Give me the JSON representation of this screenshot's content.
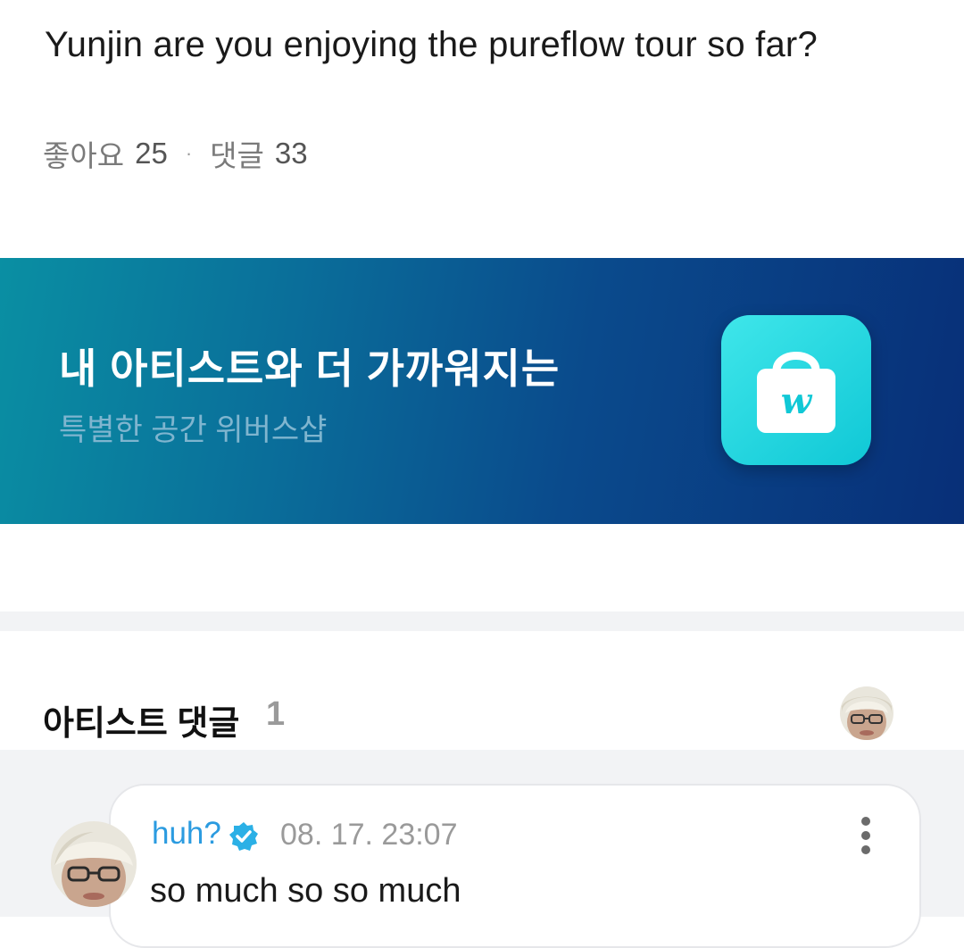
{
  "post": {
    "text": "Yunjin are you enjoying the pureflow tour so far?",
    "likes_label": "좋아요",
    "likes_count": "25",
    "separator": "·",
    "comments_label": "댓글",
    "comments_count": "33"
  },
  "banner": {
    "title": "내 아티스트와 더 가까워지는",
    "subtitle": "특별한 공간 위버스샵",
    "icon": "weverse-shop-bag-icon",
    "icon_letter": "w",
    "colors": {
      "gradient_start": "#0a8fa3",
      "gradient_end": "#082f78",
      "icon_bg": "#10c8d6"
    }
  },
  "artist_comments": {
    "title": "아티스트 댓글",
    "count": "1",
    "comments": [
      {
        "author": "huh?",
        "verified": true,
        "timestamp": "08. 17. 23:07",
        "text": "so much so so much"
      }
    ]
  },
  "colors": {
    "author_name": "#2b9be0",
    "muted_text": "#9a9a9a",
    "section_bg": "#f2f3f5"
  }
}
